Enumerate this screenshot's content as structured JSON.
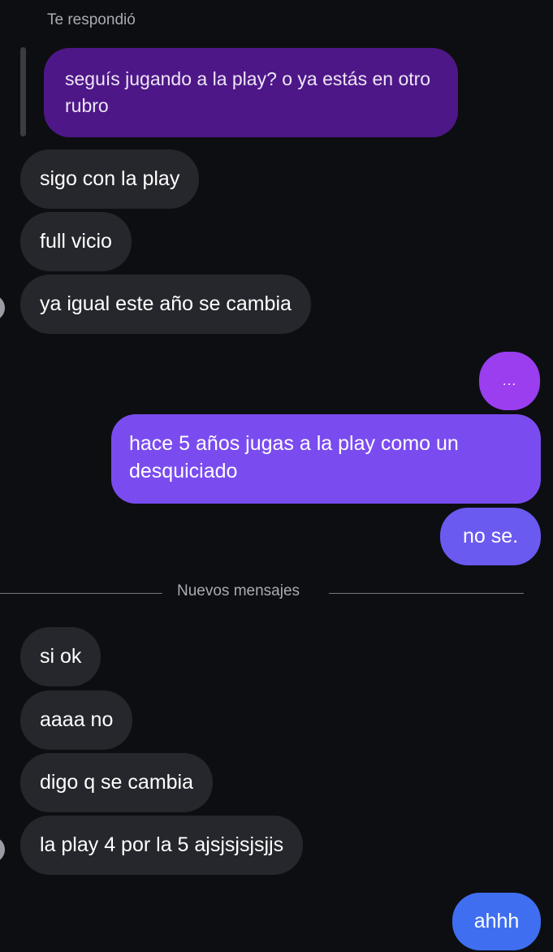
{
  "thread": {
    "reply_label": "Te respondió",
    "quoted_message": "seguís jugando a la play? o ya estás en otro rubro",
    "new_messages_label": "Nuevos mensajes",
    "messages": [
      {
        "from": "them",
        "text": "sigo con la play"
      },
      {
        "from": "them",
        "text": "full vicio"
      },
      {
        "from": "them",
        "text": "ya igual este año se cambia"
      },
      {
        "from": "me",
        "text": "..."
      },
      {
        "from": "me",
        "text": "hace 5 años jugas a la play como un desquiciado"
      },
      {
        "from": "me",
        "text": "no se."
      },
      {
        "from": "them",
        "text": "si ok"
      },
      {
        "from": "them",
        "text": "aaaa no"
      },
      {
        "from": "them",
        "text": "digo q se cambia"
      },
      {
        "from": "them",
        "text": "la play 4 por la 5 ajsjsjsjsjjs"
      },
      {
        "from": "me",
        "text": "ahhh"
      }
    ]
  },
  "colors": {
    "background": "#0d0e12",
    "incoming_bubble": "#26272c",
    "quoted_bubble": "#4e1788",
    "outgoing_gradient": [
      "#9b3df0",
      "#7a4cf0",
      "#6a5af0",
      "#5a64ee",
      "#3f6ff0"
    ]
  }
}
